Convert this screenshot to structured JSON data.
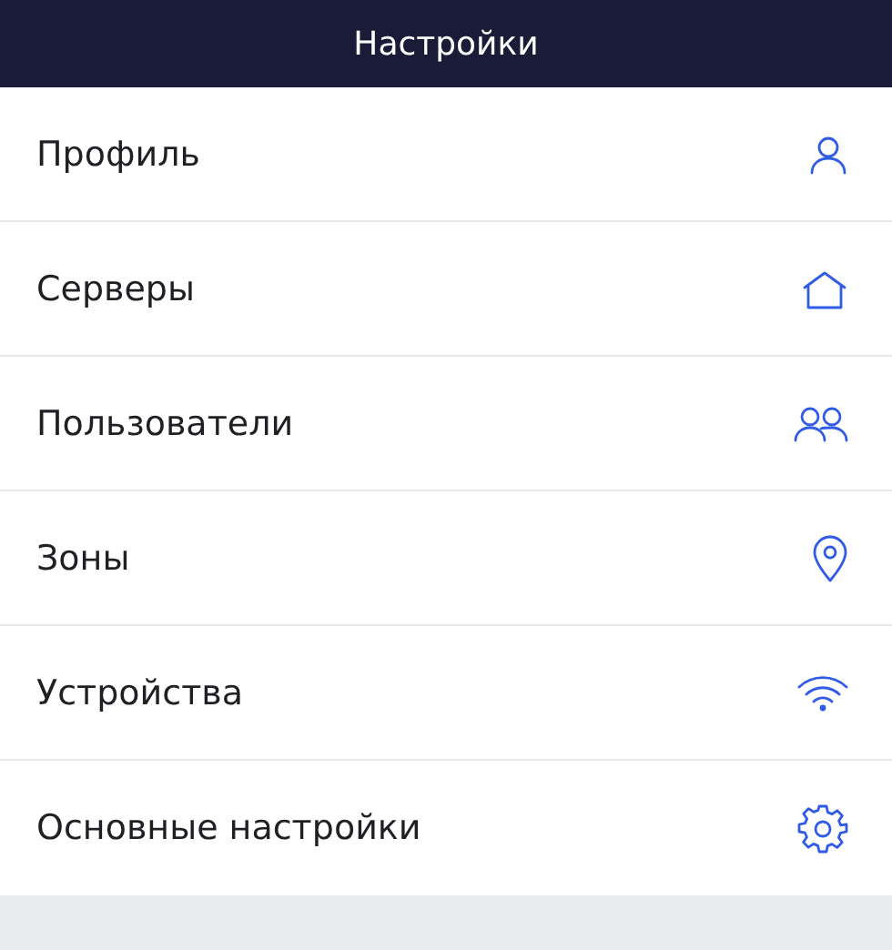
{
  "header": {
    "title": "Настройки"
  },
  "items": [
    {
      "label": "Профиль"
    },
    {
      "label": "Серверы"
    },
    {
      "label": "Пользователи"
    },
    {
      "label": "Зоны"
    },
    {
      "label": "Устройства"
    },
    {
      "label": "Основные настройки"
    }
  ]
}
